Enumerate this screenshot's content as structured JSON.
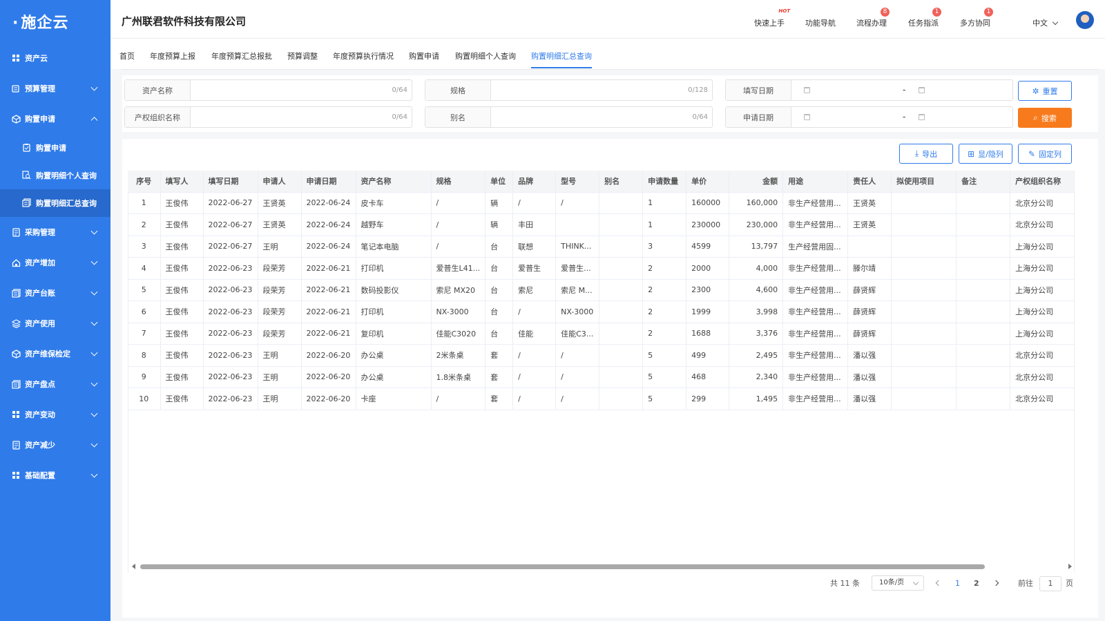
{
  "logo": "施企云",
  "sidebar": {
    "items": [
      {
        "label": "资产云",
        "icon": "grid-icon",
        "expandable": false
      },
      {
        "label": "预算管理",
        "icon": "budget-icon",
        "expandable": true
      },
      {
        "label": "购置申请",
        "icon": "cube-icon",
        "expandable": true,
        "expanded": true,
        "children": [
          {
            "label": "购置申请",
            "icon": "clipboard-icon"
          },
          {
            "label": "购置明细个人查询",
            "icon": "search-doc-icon"
          },
          {
            "label": "购置明细汇总查询",
            "icon": "stack-doc-icon",
            "active": true
          }
        ]
      },
      {
        "label": "采购管理",
        "icon": "purchase-icon",
        "expandable": true
      },
      {
        "label": "资产增加",
        "icon": "home-icon",
        "expandable": true
      },
      {
        "label": "资产台账",
        "icon": "ledger-icon",
        "expandable": true
      },
      {
        "label": "资产使用",
        "icon": "layers-icon",
        "expandable": true
      },
      {
        "label": "资产维保检定",
        "icon": "cube-icon",
        "expandable": true
      },
      {
        "label": "资产盘点",
        "icon": "ledger-icon",
        "expandable": true
      },
      {
        "label": "资产变动",
        "icon": "grid-icon",
        "expandable": true
      },
      {
        "label": "资产减少",
        "icon": "purchase-icon",
        "expandable": true
      },
      {
        "label": "基础配置",
        "icon": "grid-icon",
        "expandable": true
      }
    ]
  },
  "header": {
    "company": "广州联君软件科技有限公司",
    "links": [
      {
        "label": "快速上手",
        "hot": "HOT"
      },
      {
        "label": "功能导航"
      },
      {
        "label": "流程办理",
        "badge": "8"
      },
      {
        "label": "任务指派",
        "badge": "1"
      },
      {
        "label": "多方协同",
        "badge": "1"
      }
    ],
    "language": "中文"
  },
  "tabs": [
    "首页",
    "年度预算上报",
    "年度预算汇总报批",
    "预算调整",
    "年度预算执行情况",
    "购置申请",
    "购置明细个人查询",
    "购置明细汇总查询"
  ],
  "active_tab": "购置明细汇总查询",
  "filters": {
    "asset_name": {
      "label": "资产名称",
      "count": "0/64"
    },
    "spec": {
      "label": "规格",
      "count": "0/128"
    },
    "fill_date": {
      "label": "填写日期",
      "separator": "-"
    },
    "org_name": {
      "label": "产权组织名称",
      "count": "0/64"
    },
    "alias": {
      "label": "别名",
      "count": "0/64"
    },
    "apply_date": {
      "label": "申请日期",
      "separator": "-"
    },
    "reset_label": "重置",
    "search_label": "搜索"
  },
  "toolbar": {
    "export_label": "导出",
    "columns_label": "显/隐列",
    "fix_label": "固定列"
  },
  "table": {
    "columns": [
      "序号",
      "填写人",
      "填写日期",
      "申请人",
      "申请日期",
      "资产名称",
      "规格",
      "单位",
      "品牌",
      "型号",
      "别名",
      "申请数量",
      "单价",
      "金额",
      "用途",
      "责任人",
      "拟使用项目",
      "备注",
      "产权组织名称"
    ],
    "rows": [
      [
        "1",
        "王俊伟",
        "2022-06-27",
        "王贤英",
        "2022-06-24",
        "皮卡车",
        "/",
        "辆",
        "/",
        "/",
        "",
        "1",
        "160000",
        "160,000",
        "非生产经营用...",
        "王贤英",
        "",
        "",
        "北京分公司"
      ],
      [
        "2",
        "王俊伟",
        "2022-06-27",
        "王贤英",
        "2022-06-24",
        "越野车",
        "/",
        "辆",
        "丰田",
        "",
        "",
        "1",
        "230000",
        "230,000",
        "非生产经营用...",
        "王贤英",
        "",
        "",
        "北京分公司"
      ],
      [
        "3",
        "王俊伟",
        "2022-06-27",
        "王明",
        "2022-06-24",
        "笔记本电脑",
        "/",
        "台",
        "联想",
        "THINK...",
        "",
        "3",
        "4599",
        "13,797",
        "生产经营用固...",
        "",
        "",
        "",
        "上海分公司"
      ],
      [
        "4",
        "王俊伟",
        "2022-06-23",
        "段荣芳",
        "2022-06-21",
        "打印机",
        "爱普生L41...",
        "台",
        "爱普生",
        "爱普生...",
        "",
        "2",
        "2000",
        "4,000",
        "非生产经营用...",
        "滕尔靖",
        "",
        "",
        "上海分公司"
      ],
      [
        "5",
        "王俊伟",
        "2022-06-23",
        "段荣芳",
        "2022-06-21",
        "数码投影仪",
        "索尼 MX20",
        "台",
        "索尼",
        "索尼 M...",
        "",
        "2",
        "2300",
        "4,600",
        "非生产经营用...",
        "薛贤辉",
        "",
        "",
        "上海分公司"
      ],
      [
        "6",
        "王俊伟",
        "2022-06-23",
        "段荣芳",
        "2022-06-21",
        "打印机",
        "NX-3000",
        "台",
        "/",
        "NX-3000",
        "",
        "2",
        "1999",
        "3,998",
        "非生产经营用...",
        "薛贤辉",
        "",
        "",
        "上海分公司"
      ],
      [
        "7",
        "王俊伟",
        "2022-06-23",
        "段荣芳",
        "2022-06-21",
        "复印机",
        "佳能C3020",
        "台",
        "佳能",
        "佳能C3...",
        "",
        "2",
        "1688",
        "3,376",
        "非生产经营用...",
        "薛贤辉",
        "",
        "",
        "上海分公司"
      ],
      [
        "8",
        "王俊伟",
        "2022-06-23",
        "王明",
        "2022-06-20",
        "办公桌",
        "2米条桌",
        "套",
        "/",
        "/",
        "",
        "5",
        "499",
        "2,495",
        "非生产经营用...",
        "潘以强",
        "",
        "",
        "北京分公司"
      ],
      [
        "9",
        "王俊伟",
        "2022-06-23",
        "王明",
        "2022-06-20",
        "办公桌",
        "1.8米条桌",
        "套",
        "/",
        "/",
        "",
        "5",
        "468",
        "2,340",
        "非生产经营用...",
        "潘以强",
        "",
        "",
        "北京分公司"
      ],
      [
        "10",
        "王俊伟",
        "2022-06-23",
        "王明",
        "2022-06-20",
        "卡座",
        "/",
        "套",
        "/",
        "/",
        "",
        "5",
        "299",
        "1,495",
        "非生产经营用...",
        "潘以强",
        "",
        "",
        "北京分公司"
      ]
    ]
  },
  "pagination": {
    "total": "共 11 条",
    "page_size": "10条/页",
    "pages": [
      "1",
      "2"
    ],
    "current": "1",
    "jump_prefix": "前往",
    "jump_value": "1",
    "jump_suffix": "页"
  },
  "colors": {
    "sidebar": "#2f7bea",
    "accent": "#2f7bea",
    "search": "#f77a1c",
    "badge": "#f0625b"
  }
}
